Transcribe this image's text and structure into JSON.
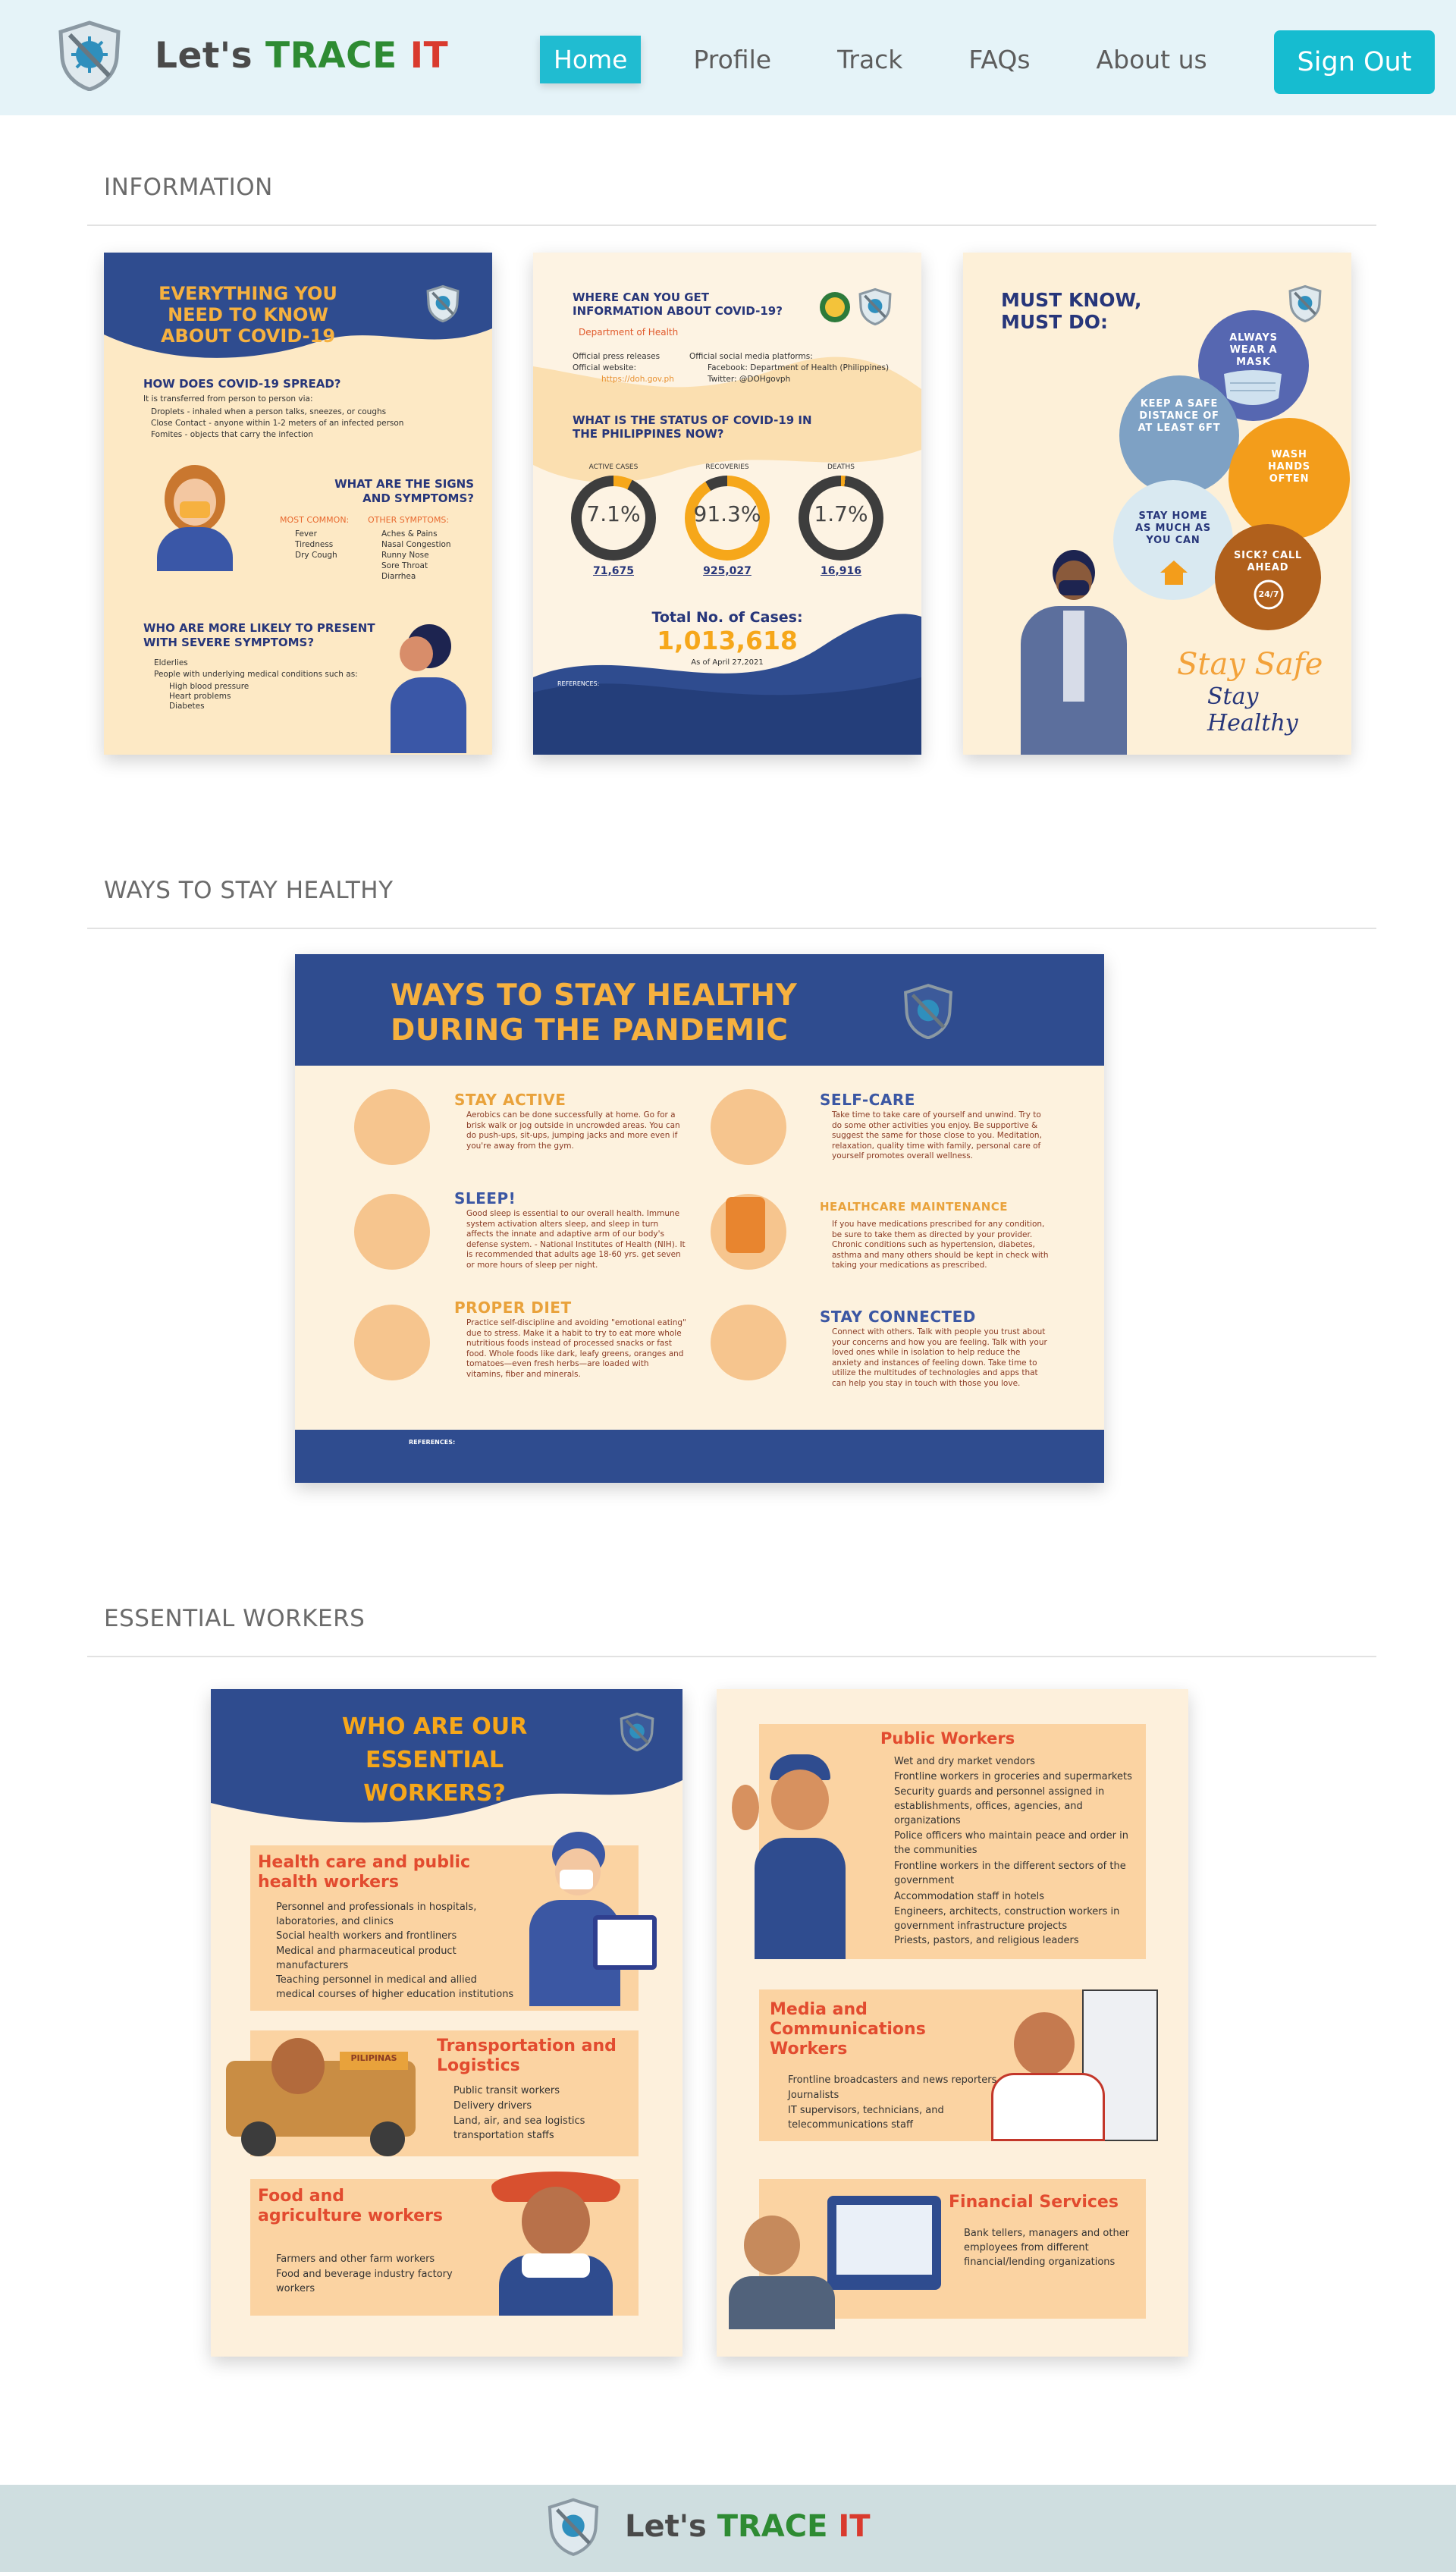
{
  "brand": {
    "prefix": "Let's ",
    "highlight_green": "TRACE",
    "highlight_red": "IT"
  },
  "nav": {
    "items": [
      "Home",
      "Profile",
      "Track",
      "FAQs",
      "About us"
    ],
    "active": "Home",
    "signout_label": "Sign Out"
  },
  "sections": {
    "information": "INFORMATION",
    "healthy": "WAYS TO STAY HEALTHY",
    "workers": "ESSENTIAL WORKERS"
  },
  "poster_covid": {
    "title": "EVERYTHING YOU NEED TO KNOW ABOUT COVID-19",
    "spread_heading": "HOW DOES COVID-19 SPREAD?",
    "spread_intro": "It is transferred from person to person via:",
    "spread_items": [
      "Droplets - inhaled when a person talks, sneezes, or coughs",
      "Close Contact - anyone within 1-2 meters of an infected person",
      "Fomites - objects that carry the infection"
    ],
    "signs_heading": "WHAT ARE THE SIGNS AND SYMPTOMS?",
    "most_common_label": "MOST COMMON:",
    "other_label": "OTHER SYMPTOMS:",
    "most_common": [
      "Fever",
      "Tiredness",
      "Dry Cough"
    ],
    "other": [
      "Aches & Pains",
      "Nasal Congestion",
      "Runny Nose",
      "Sore Throat",
      "Diarrhea"
    ],
    "likely_heading": "WHO ARE MORE LIKELY TO PRESENT WITH SEVERE SYMPTOMS?",
    "likely_items": [
      "Elderlies",
      "People with underlying medical conditions such as:"
    ],
    "conditions": [
      "High blood pressure",
      "Heart problems",
      "Diabetes"
    ]
  },
  "poster_status": {
    "where_heading": "WHERE CAN YOU GET INFORMATION ABOUT COVID-19?",
    "doh": "Department of Health",
    "sources_left": [
      "Official press releases",
      "Official website:",
      "https://doh.gov.ph"
    ],
    "sources_right": [
      "Official social media platforms:",
      "Facebook: Department of Health (Philippines)",
      "Twitter: @DOHgovph"
    ],
    "status_heading": "WHAT IS THE STATUS OF COVID-19 IN THE PHILIPPINES NOW?",
    "stats": [
      {
        "label": "ACTIVE CASES",
        "pct": "7.1%",
        "count": "71,675",
        "fraction": 0.071,
        "color": "#f6a71a"
      },
      {
        "label": "RECOVERIES",
        "pct": "91.3%",
        "count": "925,027",
        "fraction": 0.913,
        "color": "#f6a71a"
      },
      {
        "label": "DEATHS",
        "pct": "1.7%",
        "count": "16,916",
        "fraction": 0.017,
        "color": "#f6a71a"
      }
    ],
    "total_label": "Total No. of Cases:",
    "total_value": "1,013,618",
    "as_of": "As of April 27,2021",
    "references_label": "REFERENCES:"
  },
  "poster_mustdo": {
    "title": "MUST KNOW, MUST DO:",
    "bubbles": [
      "ALWAYS WEAR A MASK",
      "KEEP A SAFE DISTANCE OF AT LEAST 6FT",
      "WASH HANDS OFTEN",
      "STAY HOME AS MUCH AS YOU CAN",
      "SICK? CALL AHEAD"
    ],
    "stay_safe": "Stay Safe",
    "stay_healthy": "Stay Healthy",
    "badge": "24/7"
  },
  "poster_healthy": {
    "title_line1": "WAYS TO STAY HEALTHY",
    "title_line2": "DURING THE PANDEMIC",
    "tips": [
      {
        "heading": "STAY ACTIVE",
        "text": "Aerobics can be done successfully at home. Go for a brisk walk or jog outside in uncrowded areas. You can do push-ups, sit-ups, jumping jacks and more even if you're away from the gym."
      },
      {
        "heading": "SELF-CARE",
        "text": "Take time to take care of yourself and unwind. Try to do some other activities you enjoy. Be supportive & suggest the same for those close to you. Meditation, relaxation, quality time with family, personal care of yourself promotes overall wellness."
      },
      {
        "heading": "SLEEP!",
        "text": "Good sleep is essential to our overall health. Immune system activation alters sleep, and sleep in turn affects the innate and adaptive arm of our body's defense system. - National Institutes of Health (NIH). It is recommended that adults age 18-60 yrs. get seven or more hours of sleep per night."
      },
      {
        "heading": "HEALTHCARE MAINTENANCE",
        "text": "If you have medications prescribed for any condition, be sure to take them as directed by your provider. Chronic conditions such as hypertension, diabetes, asthma and many others should be kept in check with taking your medications as prescribed."
      },
      {
        "heading": "PROPER DIET",
        "text": "Practice self-discipline and avoiding \"emotional eating\" due to stress. Make it a habit to try to eat more whole nutritious foods instead of processed snacks or fast food. Whole foods like dark, leafy greens, oranges and tomatoes—even fresh herbs—are loaded with vitamins, fiber and minerals."
      },
      {
        "heading": "STAY CONNECTED",
        "text": "Connect with others. Talk with people you trust about your concerns and how you are feeling. Talk with your loved ones while in isolation to help reduce the anxiety and instances of feeling down. Take time to utilize the multitudes of technologies and apps that can help you stay in touch with those you love."
      }
    ],
    "references_label": "REFERENCES:"
  },
  "poster_workers": {
    "title": "WHO ARE OUR ESSENTIAL WORKERS?",
    "cards": [
      {
        "heading": "Health care and public health workers",
        "items": [
          "Personnel and professionals in hospitals, laboratories, and clinics",
          "Social health workers and frontliners",
          "Medical and pharmaceutical product manufacturers",
          "Teaching personnel in medical and allied medical courses of higher education institutions"
        ]
      },
      {
        "heading": "Transportation and Logistics",
        "items": [
          "Public transit workers",
          "Delivery drivers",
          "Land, air, and sea logistics transportation staffs"
        ]
      },
      {
        "heading": "Food and agriculture workers",
        "items": [
          "Farmers and other farm workers",
          "Food and beverage industry factory workers"
        ]
      }
    ]
  },
  "poster_workers2": {
    "cards": [
      {
        "heading": "Public Workers",
        "items": [
          "Wet and dry market vendors",
          "Frontline workers in groceries and supermarkets",
          "Security guards and personnel assigned in establishments, offices, agencies, and organizations",
          "Police officers who maintain peace and order in the communities",
          "Frontline workers in the different sectors of the government",
          "Accommodation staff in hotels",
          "Engineers, architects, construction workers in government infrastructure projects",
          "Priests, pastors, and religious leaders"
        ]
      },
      {
        "heading": "Media and Communications Workers",
        "items": [
          "Frontline broadcasters and news reporters",
          "Journalists",
          "IT supervisors, technicians, and telecommunications staff"
        ]
      },
      {
        "heading": "Financial Services",
        "items": [
          "Bank tellers, managers and other employees from different financial/lending organizations"
        ]
      }
    ],
    "truck_sign": "PILIPINAS"
  },
  "colors": {
    "accent": "#16bcd0",
    "navy": "#2f4c8f",
    "orange": "#f6b13f",
    "brand_green": "#2e8b33",
    "brand_red": "#d93a2e"
  }
}
